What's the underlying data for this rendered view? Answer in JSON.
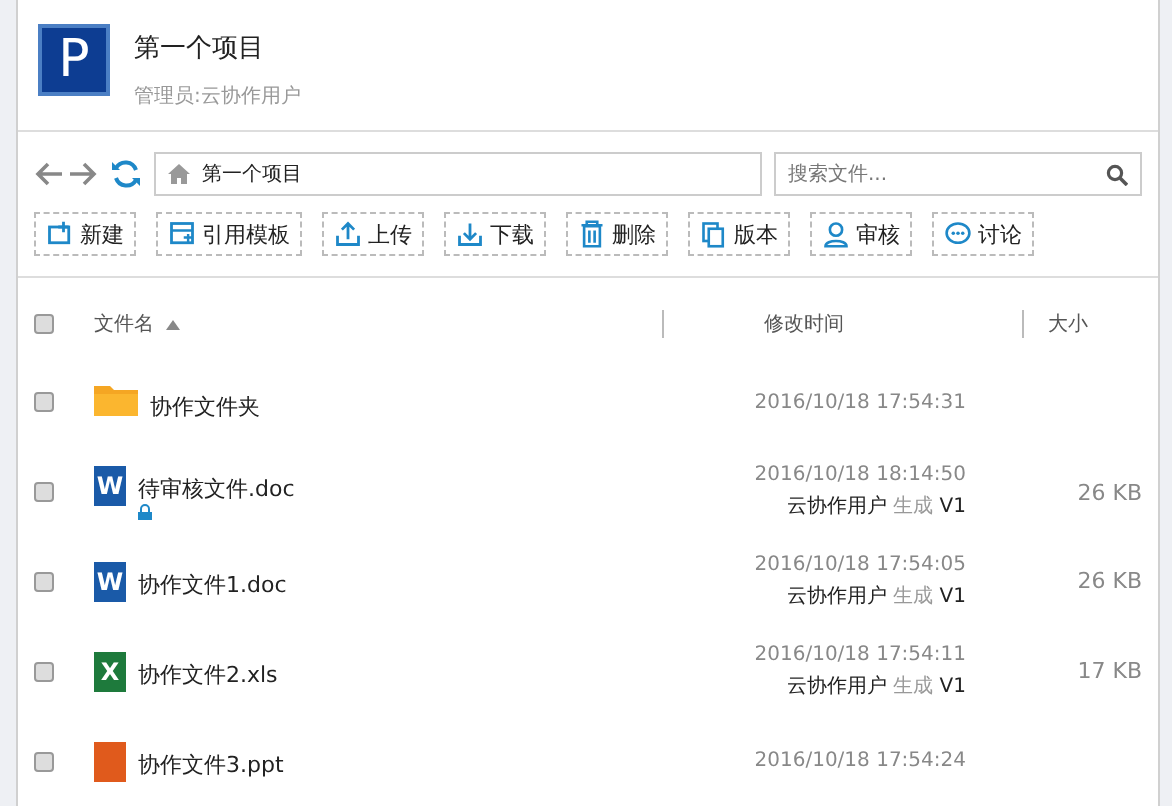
{
  "project": {
    "title": "第一个项目",
    "subtitle": "管理员:云协作用户",
    "logo": "P"
  },
  "path": {
    "value": "第一个项目"
  },
  "search": {
    "placeholder": "搜索文件..."
  },
  "toolbar": [
    {
      "kind": "new",
      "label": "新建"
    },
    {
      "kind": "template",
      "label": "引用模板"
    },
    {
      "kind": "upload",
      "label": "上传"
    },
    {
      "kind": "download",
      "label": "下载"
    },
    {
      "kind": "delete",
      "label": "删除"
    },
    {
      "kind": "version",
      "label": "版本"
    },
    {
      "kind": "review",
      "label": "审核"
    },
    {
      "kind": "discuss",
      "label": "讨论"
    }
  ],
  "table": {
    "columns": [
      "文件名",
      "修改时间",
      "大小"
    ],
    "select_all": {
      "checked": false
    },
    "rows": [
      {
        "kind": "folder",
        "name": "协作文件夹",
        "checked": false,
        "locked": false,
        "time": "2016/10/18 17:54:31"
      },
      {
        "kind": "word",
        "icon_text": "W",
        "name": "待审核文件.doc",
        "checked": false,
        "locked": true,
        "time": "2016/10/18 18:14:50",
        "user": "云协作用户",
        "action": "生成",
        "version": "V1",
        "size": "26 KB"
      },
      {
        "kind": "word",
        "icon_text": "W",
        "name": "协作文件1.doc",
        "checked": false,
        "locked": false,
        "time": "2016/10/18 17:54:05",
        "user": "云协作用户",
        "action": "生成",
        "version": "V1",
        "size": "26 KB"
      },
      {
        "kind": "excel",
        "icon_text": "X",
        "name": "协作文件2.xls",
        "checked": false,
        "locked": false,
        "time": "2016/10/18 17:54:11",
        "user": "云协作用户",
        "action": "生成",
        "version": "V1",
        "size": "17 KB"
      },
      {
        "kind": "ppt",
        "name": "协作文件3.ppt",
        "checked": false,
        "locked": false,
        "time": "2016/10/18 17:54:24"
      }
    ]
  }
}
